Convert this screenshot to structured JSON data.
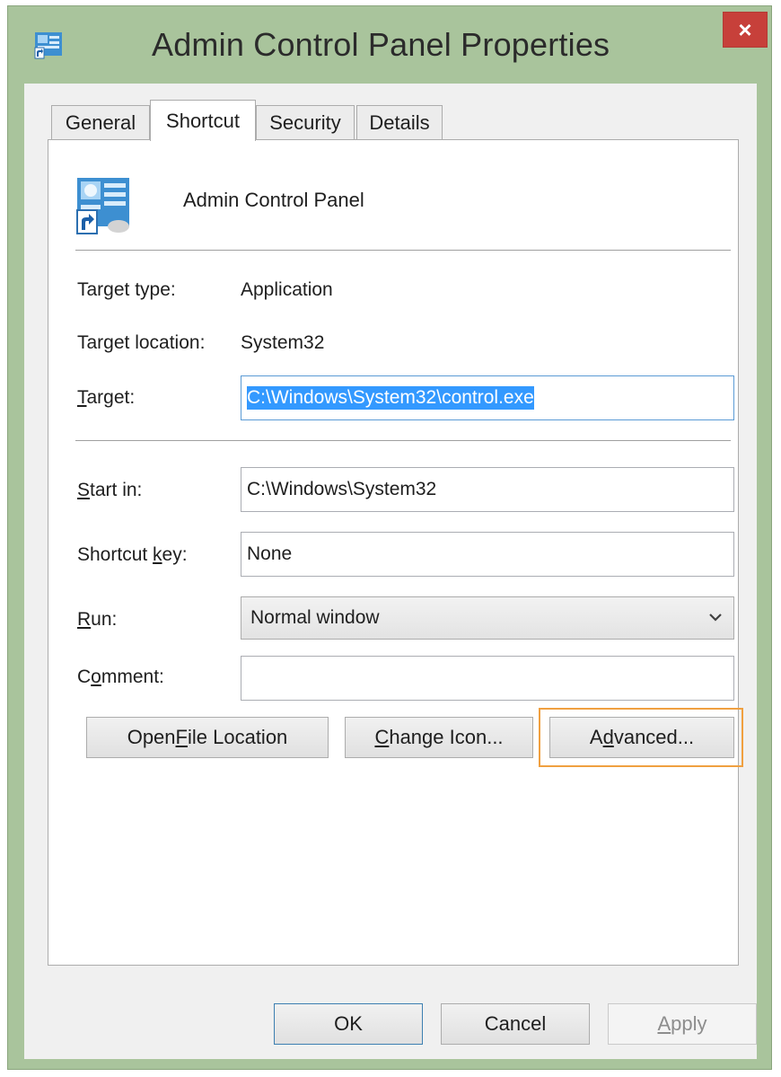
{
  "window": {
    "title": "Admin Control Panel Properties",
    "close_glyph": "×",
    "icon": "control-panel-icon"
  },
  "tabs": [
    {
      "label": "General",
      "active": false
    },
    {
      "label": "Shortcut",
      "active": true
    },
    {
      "label": "Security",
      "active": false
    },
    {
      "label": "Details",
      "active": false
    }
  ],
  "shortcut": {
    "app_name": "Admin Control Panel",
    "target_type_label": "Target type:",
    "target_type_value": "Application",
    "target_location_label": "Target location:",
    "target_location_value": "System32",
    "target_label_mn": "T",
    "target_label_rest": "arget:",
    "target_value": "C:\\Windows\\System32\\control.exe",
    "start_in_label_mn": "S",
    "start_in_label_rest": "tart in:",
    "start_in_value": "C:\\Windows\\System32",
    "shortcut_key_label_pre": "Shortcut ",
    "shortcut_key_label_mn": "k",
    "shortcut_key_label_rest": "ey:",
    "shortcut_key_value": "None",
    "run_label_mn": "R",
    "run_label_rest": "un:",
    "run_value": "Normal window",
    "comment_label_pre": "C",
    "comment_label_mn": "o",
    "comment_label_rest": "mment:",
    "comment_value": ""
  },
  "buttons": {
    "open_file_location_pre": "Open ",
    "open_file_location_mn": "F",
    "open_file_location_rest": "ile Location",
    "change_icon_mn": "C",
    "change_icon_rest": "hange Icon...",
    "advanced_pre": "A",
    "advanced_mn": "d",
    "advanced_rest": "vanced...",
    "ok": "OK",
    "cancel": "Cancel",
    "apply_mn": "A",
    "apply_rest": "pply"
  },
  "colors": {
    "window_frame": "#a9c49c",
    "close_button": "#c7403a",
    "selection": "#3399ff",
    "focus_ring": "#f0a040"
  }
}
